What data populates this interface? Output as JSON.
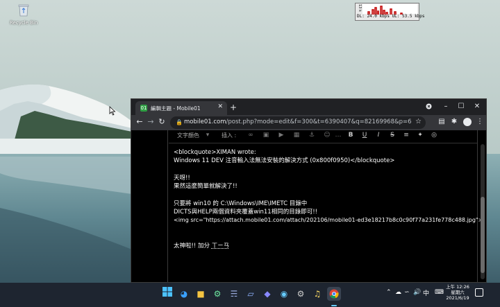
{
  "desktop": {
    "recycle_bin_label": "Recycle Bin"
  },
  "netmon": {
    "graph_label": "13 k",
    "stats": "DL: 24.0 kbps  UL: 53.5 kbps"
  },
  "browser": {
    "tab_title": "編輯主題 - Mobile01",
    "favicon_text": "01",
    "url_host": "mobile01.com",
    "url_path": "/post.php?mode=edit&f=300&t=6390407&q=82169968&p=6"
  },
  "editor": {
    "toolbar": {
      "text_color_label": "文字顏色",
      "insert_label": "插入 :"
    },
    "lines": [
      "<blockquote>XIMAN wrote:",
      "Windows 11 DEV 注音輸入法無法安裝的解決方式 (0x800f0950)</blockquote>",
      "",
      "天呀!!",
      "果然這麼簡單就解決了!!",
      "",
      "只要將 win10 的  C:\\Windows\\IME\\IMETC 目錄中",
      "DICTS與HELP兩個資料夾覆蓋win11相同的目錄即可!!",
      "<img src=\"https://attach.mobile01.com/attach/202106/mobile01-ed3e18217b8c0c90f77a231fe778c488.jpg\">",
      "",
      "",
      "太神啦!! 加分"
    ],
    "bopomofo": "ㄒㄧㄢ"
  },
  "taskbar": {
    "ime_label": "中",
    "time": "上午 12:26",
    "weekday": "星期六",
    "date": "2021/6/19"
  },
  "colors": {
    "taskbar_bg": "#1e2530",
    "chrome_dark": "#202124",
    "chrome_toolbar": "#35363a"
  }
}
